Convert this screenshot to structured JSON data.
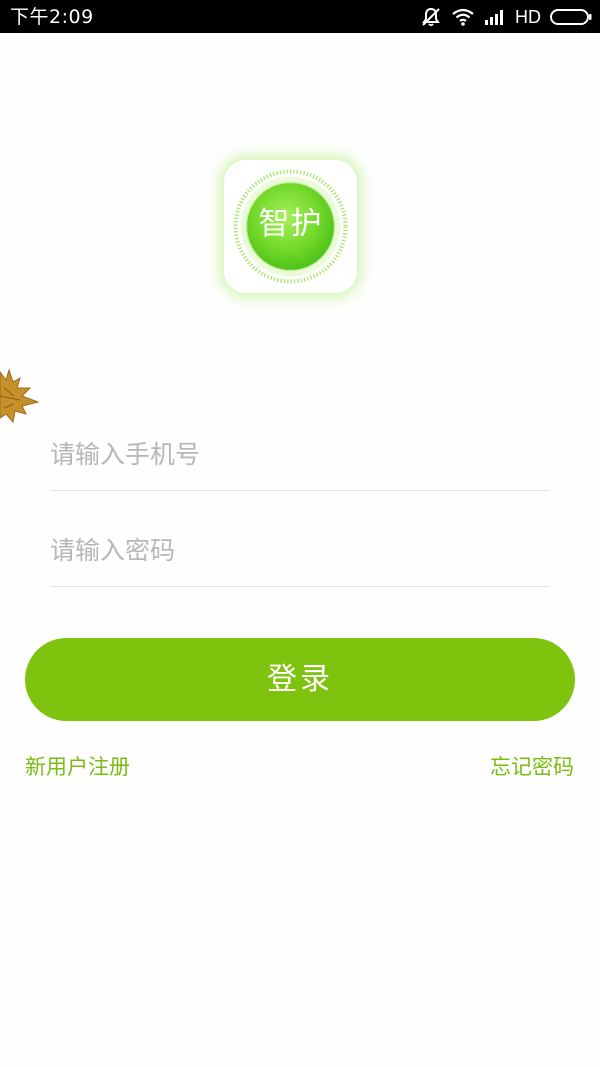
{
  "status_bar": {
    "time": "下午2:09",
    "network": "HD",
    "icons": [
      "mute-icon",
      "wifi-icon",
      "signal-icon",
      "battery-icon"
    ]
  },
  "logo": {
    "text": "智护",
    "accent_color": "#7ec40e"
  },
  "form": {
    "phone_placeholder": "请输入手机号",
    "phone_value": "",
    "password_placeholder": "请输入密码",
    "password_value": "",
    "login_label": "登录",
    "register_label": "新用户注册",
    "forgot_label": "忘记密码"
  },
  "decor": {
    "leaf_icon": "maple-leaf-icon"
  },
  "colors": {
    "primary_green": "#7ec40e",
    "link_green": "#79bd13",
    "placeholder_gray": "#b7b7b7",
    "divider_gray": "#e3e3e3"
  }
}
